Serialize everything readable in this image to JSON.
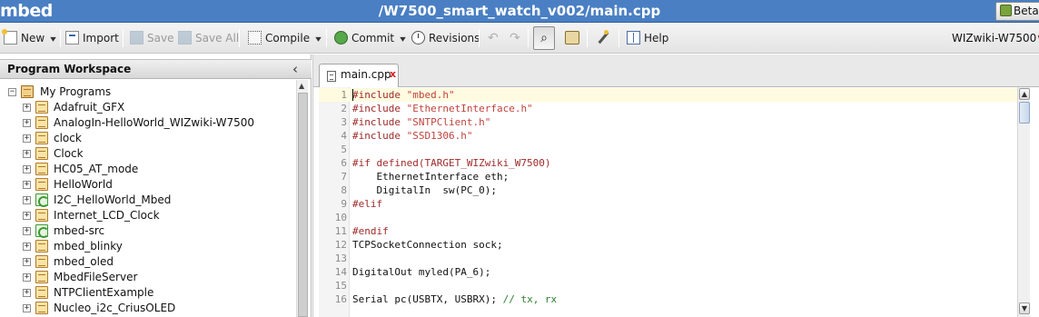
{
  "app": {
    "logo": "mbed",
    "title": "/W7500_smart_watch_v002/main.cpp",
    "beta_label": "Beta"
  },
  "toolbar": {
    "new_label": "New",
    "import_label": "Import",
    "save_label": "Save",
    "save_all_label": "Save All",
    "compile_label": "Compile",
    "commit_label": "Commit",
    "revisions_label": "Revisions",
    "help_label": "Help",
    "platform_label": "WIZwiki-W7500",
    "undo_glyph": "↶",
    "redo_glyph": "↷",
    "dropdown_glyph": "▾",
    "find_glyph": "⌕"
  },
  "workspace": {
    "title": "Program Workspace",
    "collapse_glyph": "‹",
    "root_label": "My Programs",
    "items": [
      {
        "label": "Adafruit_GFX",
        "icon": "program-icon"
      },
      {
        "label": "AnalogIn-HelloWorld_WIZwiki-W7500",
        "icon": "program-icon"
      },
      {
        "label": "clock",
        "icon": "program-icon"
      },
      {
        "label": "Clock",
        "icon": "program-icon"
      },
      {
        "label": "HC05_AT_mode",
        "icon": "program-icon"
      },
      {
        "label": "HelloWorld",
        "icon": "program-icon"
      },
      {
        "label": "I2C_HelloWorld_Mbed",
        "icon": "library-icon"
      },
      {
        "label": "Internet_LCD_Clock",
        "icon": "program-icon"
      },
      {
        "label": "mbed-src",
        "icon": "library-icon"
      },
      {
        "label": "mbed_blinky",
        "icon": "program-icon"
      },
      {
        "label": "mbed_oled",
        "icon": "program-icon"
      },
      {
        "label": "MbedFileServer",
        "icon": "program-icon"
      },
      {
        "label": "NTPClientExample",
        "icon": "program-icon"
      },
      {
        "label": "Nucleo_i2c_CriusOLED",
        "icon": "program-icon"
      }
    ]
  },
  "editor": {
    "tab_label": "main.cpp",
    "tab_close": "x",
    "lines": [
      {
        "n": "1",
        "parts": [
          {
            "t": "#include ",
            "c": "pre"
          },
          {
            "t": "\"mbed.h\"",
            "c": "str"
          }
        ]
      },
      {
        "n": "2",
        "parts": [
          {
            "t": "#include ",
            "c": "pre"
          },
          {
            "t": "\"EthernetInterface.h\"",
            "c": "str"
          }
        ]
      },
      {
        "n": "3",
        "parts": [
          {
            "t": "#include ",
            "c": "pre"
          },
          {
            "t": "\"SNTPClient.h\"",
            "c": "str"
          }
        ]
      },
      {
        "n": "4",
        "parts": [
          {
            "t": "#include ",
            "c": "pre"
          },
          {
            "t": "\"SSD1306.h\"",
            "c": "str"
          }
        ]
      },
      {
        "n": "5",
        "parts": []
      },
      {
        "n": "6",
        "parts": [
          {
            "t": "#if defined(TARGET_WIZwiki_W7500)",
            "c": "pre"
          }
        ]
      },
      {
        "n": "7",
        "parts": [
          {
            "t": "    EthernetInterface eth;",
            "c": "txt"
          }
        ]
      },
      {
        "n": "8",
        "parts": [
          {
            "t": "    DigitalIn  sw(PC_0);",
            "c": "txt"
          }
        ]
      },
      {
        "n": "9",
        "parts": [
          {
            "t": "#elif",
            "c": "pre"
          }
        ]
      },
      {
        "n": "10",
        "parts": []
      },
      {
        "n": "11",
        "parts": [
          {
            "t": "#endif",
            "c": "pre"
          }
        ]
      },
      {
        "n": "12",
        "parts": [
          {
            "t": "TCPSocketConnection sock;",
            "c": "txt"
          }
        ]
      },
      {
        "n": "13",
        "parts": []
      },
      {
        "n": "14",
        "parts": [
          {
            "t": "DigitalOut myled(PA_6);",
            "c": "txt"
          }
        ]
      },
      {
        "n": "15",
        "parts": []
      },
      {
        "n": "16",
        "parts": [
          {
            "t": "Serial pc(USBTX, USBRX); ",
            "c": "txt"
          },
          {
            "t": "// tx, rx",
            "c": "com"
          }
        ]
      }
    ]
  },
  "colors": {
    "titlebar": "#4a7fc3",
    "preprocessor": "#a02a2a",
    "string": "#c0443d",
    "comment": "#2f7d2f"
  }
}
